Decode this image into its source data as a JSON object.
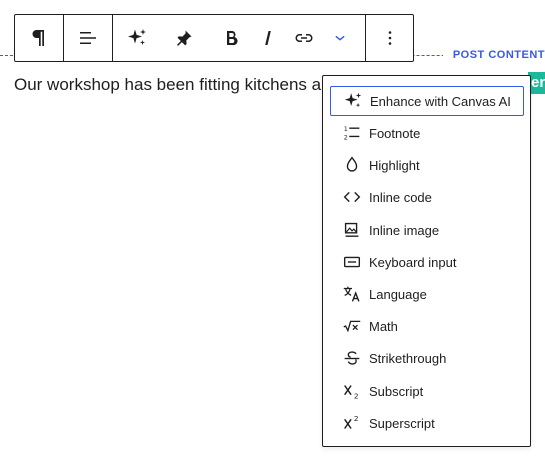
{
  "content": {
    "paragraph_text": "Our workshop has been fitting kitchens a",
    "post_content_label": "POST CONTENT",
    "right_tab_text": "en"
  },
  "toolbar": {
    "buttons": [
      {
        "id": "paragraph",
        "icon": "pilcrow-icon"
      },
      {
        "id": "align",
        "icon": "align-left-icon"
      },
      {
        "id": "ai",
        "icon": "sparkles-icon"
      },
      {
        "id": "pin",
        "icon": "pin-icon"
      },
      {
        "id": "bold",
        "icon": "bold-icon"
      },
      {
        "id": "italic",
        "icon": "italic-icon"
      },
      {
        "id": "link",
        "icon": "link-icon"
      },
      {
        "id": "more-rich-text",
        "icon": "chevron-down-icon"
      },
      {
        "id": "options",
        "icon": "more-vertical-icon"
      }
    ]
  },
  "menu": {
    "items": [
      {
        "label": "Enhance with Canvas AI",
        "icon": "sparkles-icon",
        "active": true
      },
      {
        "label": "Footnote",
        "icon": "footnote-icon"
      },
      {
        "label": "Highlight",
        "icon": "droplet-icon"
      },
      {
        "label": "Inline code",
        "icon": "code-icon"
      },
      {
        "label": "Inline image",
        "icon": "image-icon"
      },
      {
        "label": "Keyboard input",
        "icon": "keyboard-icon"
      },
      {
        "label": "Language",
        "icon": "language-icon"
      },
      {
        "label": "Math",
        "icon": "math-icon"
      },
      {
        "label": "Strikethrough",
        "icon": "strikethrough-icon"
      },
      {
        "label": "Subscript",
        "icon": "subscript-icon"
      },
      {
        "label": "Superscript",
        "icon": "superscript-icon"
      }
    ]
  },
  "colors": {
    "accent": "#3858e9",
    "text": "#1e1e1e",
    "green_tab": "#1bb99a"
  }
}
